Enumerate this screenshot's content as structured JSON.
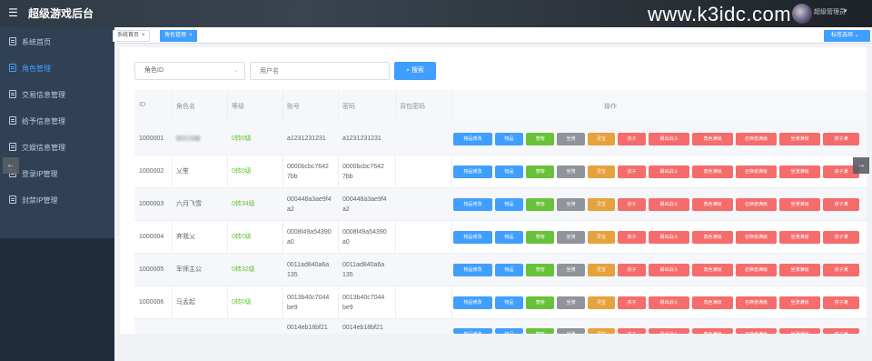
{
  "app_title": "超级游戏后台",
  "watermark": "www.k3idc.com",
  "user": {
    "name": "超级管理员"
  },
  "sidebar": {
    "items": [
      {
        "label": "系统首页"
      },
      {
        "label": "角色管理"
      },
      {
        "label": "交易信息管理"
      },
      {
        "label": "给予信息管理"
      },
      {
        "label": "交娱信息管理"
      },
      {
        "label": "登录IP管理"
      },
      {
        "label": "封禁IP管理"
      }
    ]
  },
  "tags": [
    {
      "label": "系统首页",
      "close": "×"
    },
    {
      "label": "角色管理",
      "close": "×"
    }
  ],
  "tags_options_label": "标签选项",
  "tags_options_caret": "⌄",
  "search": {
    "role_select": "角色ID",
    "user_placeholder": "用户名",
    "button_label": "搜索"
  },
  "table": {
    "headers": [
      "ID",
      "角色名",
      "等级",
      "账号",
      "密码",
      "背包密码",
      "操作"
    ],
    "rows": [
      {
        "id": "1000001",
        "name": "",
        "level": "0转0级",
        "account": [
          "a1231231231"
        ],
        "password": [
          "a1231231231"
        ]
      },
      {
        "id": "1000002",
        "name": "乂笙",
        "level": "0转0级",
        "account": [
          "0000bcbc7642",
          "7bb"
        ],
        "password": [
          "0000bcbc7642",
          "7bb"
        ]
      },
      {
        "id": "1000003",
        "name": "六月飞雪",
        "level": "0转34级",
        "account": [
          "000448a3ae9f4",
          "a2"
        ],
        "password": [
          "000448a3ae9f4",
          "a2"
        ]
      },
      {
        "id": "1000004",
        "name": "弃我乂",
        "level": "0转0级",
        "account": [
          "0008f49a54390",
          "a0"
        ],
        "password": [
          "0008f49a54390",
          "a0"
        ]
      },
      {
        "id": "1000005",
        "name": "军师主公",
        "level": "0转32级",
        "account": [
          "0011ad840a6a",
          "135"
        ],
        "password": [
          "0011ad840a6a",
          "135"
        ]
      },
      {
        "id": "1000006",
        "name": "马孟起",
        "level": "0转0级",
        "account": [
          "0013b40c7044",
          "be9"
        ],
        "password": [
          "0013b40c7044",
          "be9"
        ]
      },
      {
        "id": "",
        "name": "",
        "level": "",
        "account": [
          "0014eb18bf21"
        ],
        "password": [
          "0014eb18bf21"
        ]
      }
    ],
    "actions": [
      "物品修改",
      "物品",
      "宠物",
      "坐骑",
      "灵宝",
      "孩子",
      "踢出战斗",
      "角色满级",
      "召唤兽满级",
      "坐骑满级",
      "孩子满"
    ]
  },
  "nav": {
    "prev": "←",
    "next": "→"
  },
  "colors": {
    "primary": "#409eff",
    "success": "#67c23a",
    "info": "#909399",
    "warning": "#e6a23c",
    "danger": "#f56c6c",
    "sidebar": "#304156"
  }
}
